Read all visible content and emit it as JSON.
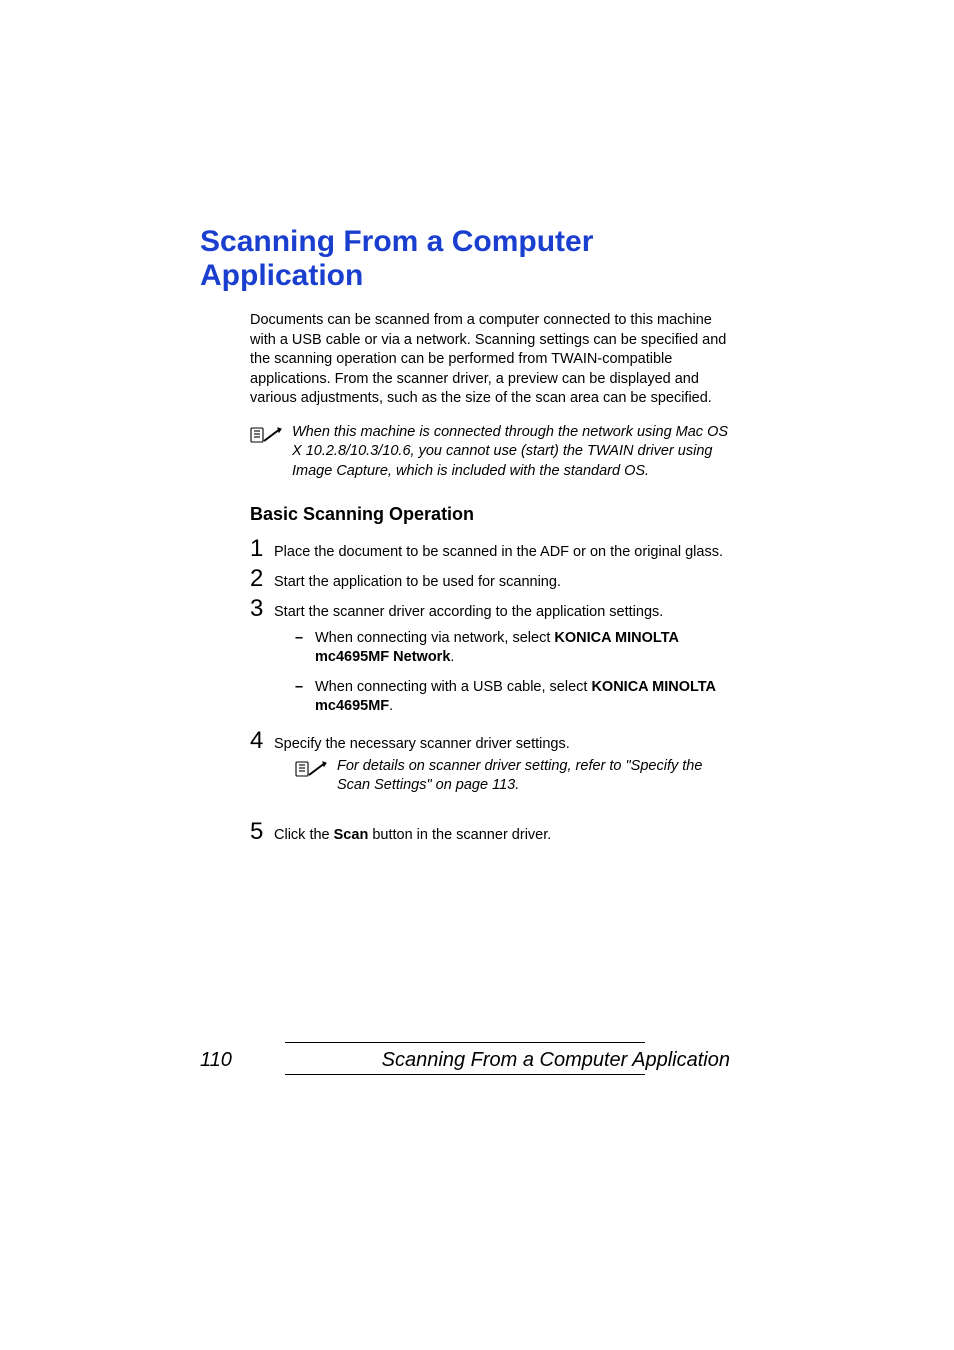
{
  "heading": "Scanning From a Computer Application",
  "intro": "Documents can be scanned from a computer connected to this machine with a USB cable or via a network. Scanning settings can be specified and the scanning operation can be performed from TWAIN-compatible applications. From the scanner driver, a preview can be displayed and various adjustments, such as the size of the scan area can be specified.",
  "note1": "When this machine is connected through the network using Mac OS X 10.2.8/10.3/10.6, you cannot use (start) the TWAIN driver using Image Capture, which is included with the standard OS.",
  "subheading": "Basic Scanning Operation",
  "steps": {
    "s1": "Place the document to be scanned in the ADF or on the original glass.",
    "s2": "Start the application to be used for scanning.",
    "s3": "Start the scanner driver according to the application settings.",
    "s3a_pre": "When connecting via network, select ",
    "s3a_bold": "KONICA MINOLTA mc4695MF Network",
    "s3a_post": ".",
    "s3b_pre": "When connecting with a USB cable, select ",
    "s3b_bold": "KONICA MINOLTA mc4695MF",
    "s3b_post": ".",
    "s4": "Specify the necessary scanner driver settings.",
    "s4_note": "For details on scanner driver setting, refer to \"Specify the Scan Settings\" on page 113.",
    "s5_pre": "Click the ",
    "s5_bold": "Scan",
    "s5_post": " button in the scanner driver."
  },
  "footer": {
    "page": "110",
    "title": "Scanning From a Computer Application"
  }
}
